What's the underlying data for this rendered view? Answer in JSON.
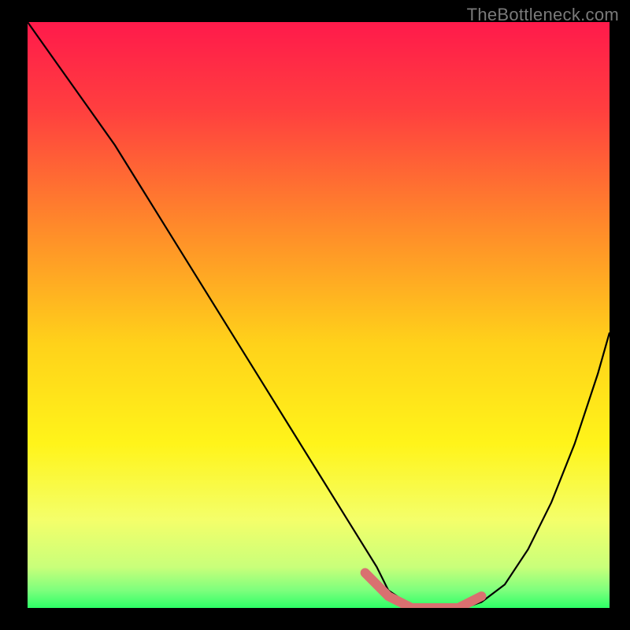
{
  "watermark": "TheBottleneck.com",
  "chart_data": {
    "type": "line",
    "title": "",
    "xlabel": "",
    "ylabel": "",
    "xlim": [
      0,
      100
    ],
    "ylim": [
      0,
      100
    ],
    "series": [
      {
        "name": "bottleneck-curve",
        "x": [
          0,
          5,
          10,
          15,
          20,
          25,
          30,
          35,
          40,
          45,
          50,
          55,
          60,
          62,
          65,
          68,
          72,
          75,
          78,
          82,
          86,
          90,
          94,
          98,
          100
        ],
        "values": [
          100,
          93,
          86,
          79,
          71,
          63,
          55,
          47,
          39,
          31,
          23,
          15,
          7,
          3,
          1,
          0,
          0,
          0,
          1,
          4,
          10,
          18,
          28,
          40,
          47
        ]
      }
    ],
    "highlight": {
      "name": "optimal-range",
      "x": [
        58,
        62,
        66,
        70,
        74,
        78
      ],
      "values": [
        6,
        2,
        0,
        0,
        0,
        2
      ]
    },
    "gradient_stops": [
      {
        "offset": 0.0,
        "color": "#ff1a4b"
      },
      {
        "offset": 0.15,
        "color": "#ff3f3f"
      },
      {
        "offset": 0.35,
        "color": "#ff8a2a"
      },
      {
        "offset": 0.55,
        "color": "#ffd21a"
      },
      {
        "offset": 0.72,
        "color": "#fff41a"
      },
      {
        "offset": 0.85,
        "color": "#f4ff6a"
      },
      {
        "offset": 0.93,
        "color": "#c9ff7a"
      },
      {
        "offset": 0.97,
        "color": "#7dff7d"
      },
      {
        "offset": 1.0,
        "color": "#2dff66"
      }
    ]
  }
}
